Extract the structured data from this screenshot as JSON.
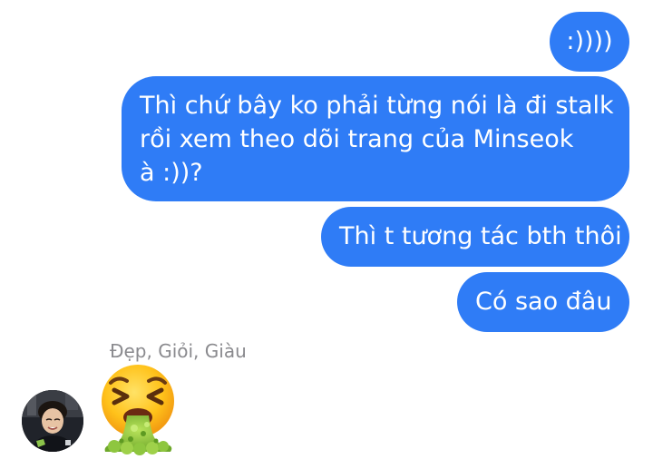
{
  "messages": [
    {
      "direction": "outgoing",
      "text": ":))))"
    },
    {
      "direction": "outgoing",
      "lines": [
        "Thì chứ bây ko phải từng nói là đi stalk",
        "rồi xem theo dõi trang của Minseok",
        "à :))?"
      ]
    },
    {
      "direction": "outgoing",
      "text": "Thì t tương tác bth thôi"
    },
    {
      "direction": "outgoing",
      "text": "Có sao đâu"
    }
  ],
  "incoming": {
    "sender_name": "Đẹp, Giỏi, Giàu",
    "reaction_emoji": "nauseated-vomiting-face",
    "avatar": "contact-avatar"
  },
  "colors": {
    "bubble_blue": "#2f7cf6",
    "bubble_text": "#ffffff",
    "sender_gray": "#8a8a8e"
  }
}
